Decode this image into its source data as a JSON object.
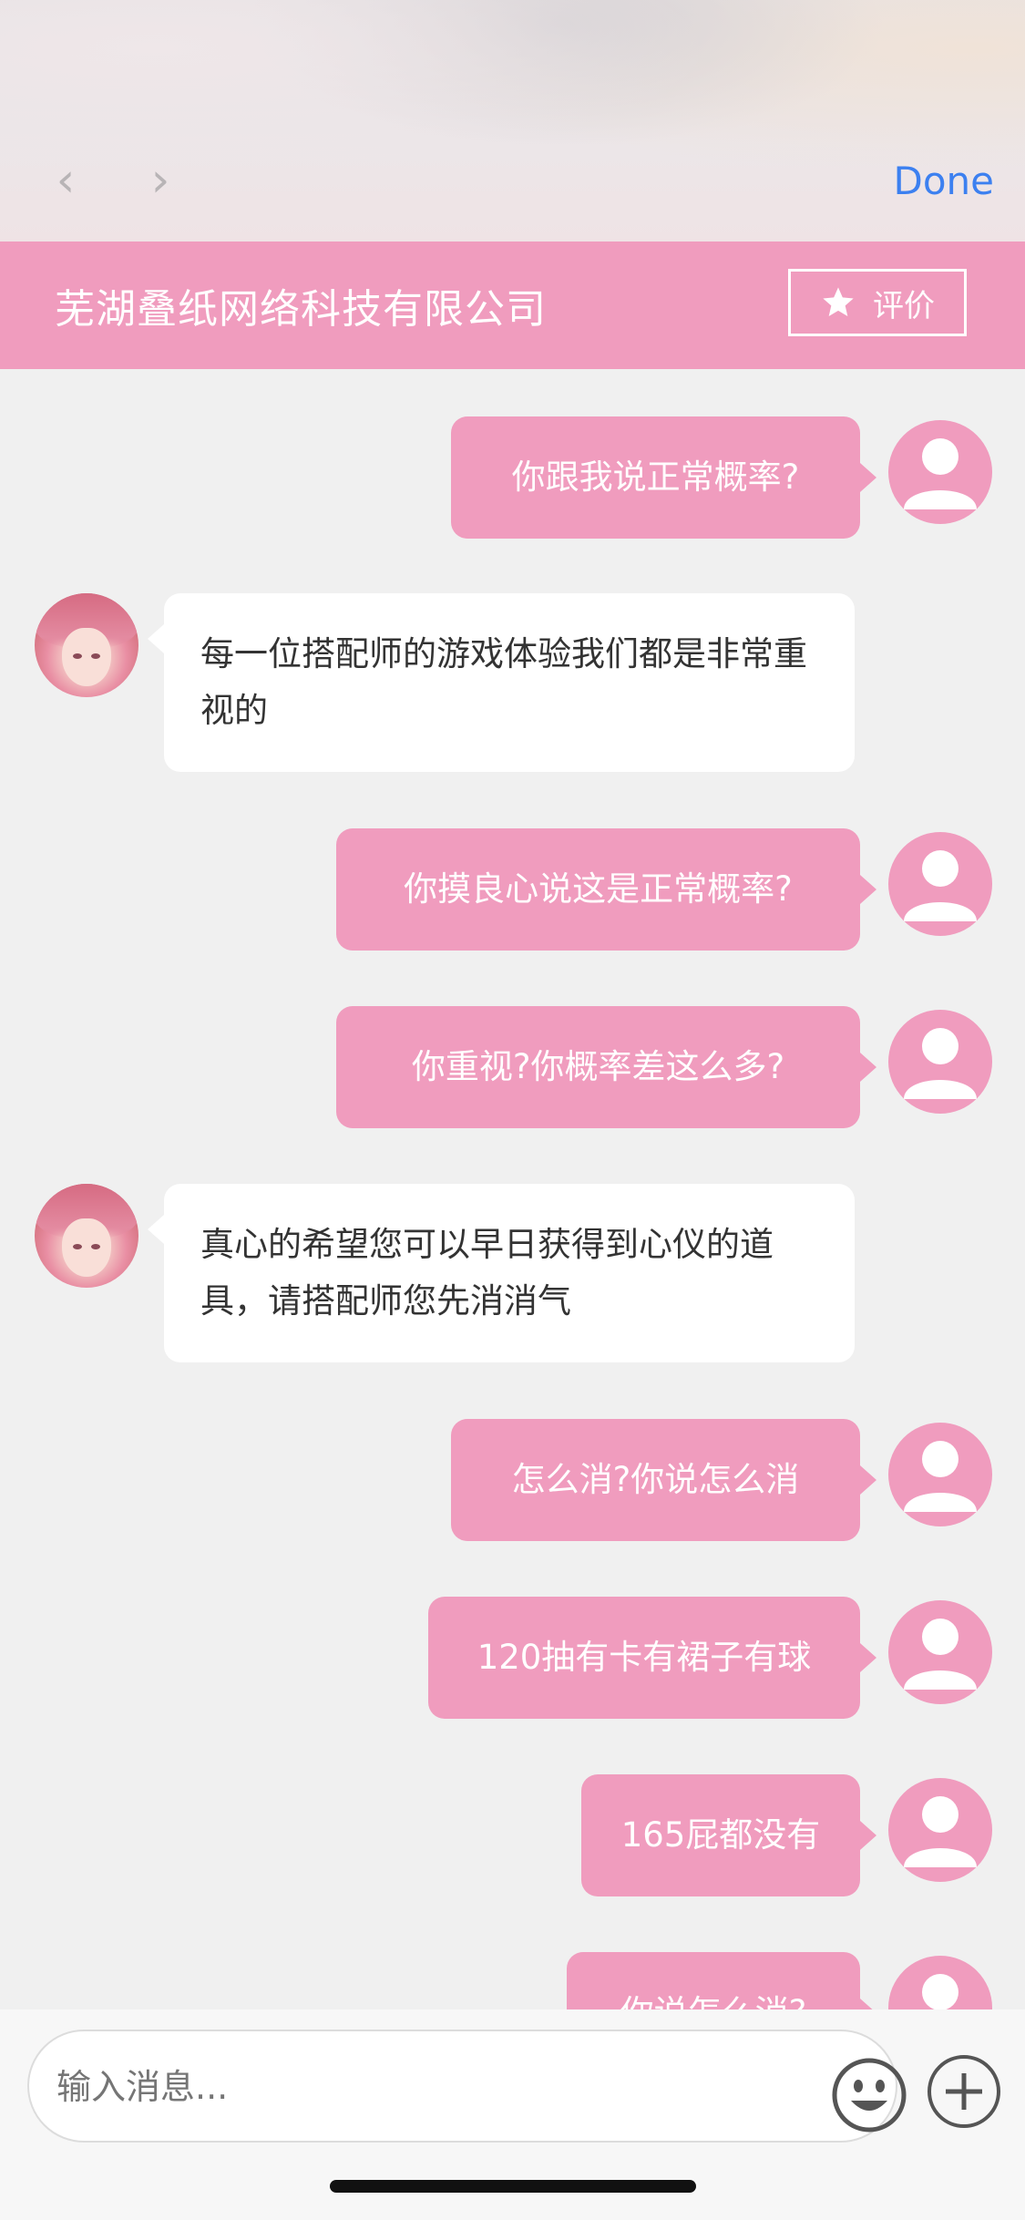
{
  "browser": {
    "back_label": "‹",
    "forward_label": "›",
    "done_label": "Done"
  },
  "header": {
    "company_name": "芜湖叠纸网络科技有限公司",
    "rate_label": "评价"
  },
  "messages": [
    {
      "from": "me",
      "text": "你跟我说正常概率?"
    },
    {
      "from": "them",
      "text": "每一位搭配师的游戏体验我们都是非常重视的"
    },
    {
      "from": "me",
      "text": "你摸良心说这是正常概率?"
    },
    {
      "from": "me",
      "text": "你重视?你概率差这么多?"
    },
    {
      "from": "them",
      "text": "真心的希望您可以早日获得到心仪的道具，请搭配师您先消消气"
    },
    {
      "from": "me",
      "text": "怎么消?你说怎么消"
    },
    {
      "from": "me",
      "text": "120抽有卡有裙子有球"
    },
    {
      "from": "me",
      "text": "165屁都没有"
    },
    {
      "from": "me",
      "text": "你说怎么消?"
    }
  ],
  "input": {
    "placeholder": "输入消息..."
  },
  "icons": {
    "rate": "star-icon",
    "emoji": "smiley-icon",
    "add": "plus-circle-icon",
    "user_avatar": "user-silhouette-icon"
  },
  "colors": {
    "accent_pink": "#f09cbe",
    "done_blue": "#3c80f0"
  }
}
